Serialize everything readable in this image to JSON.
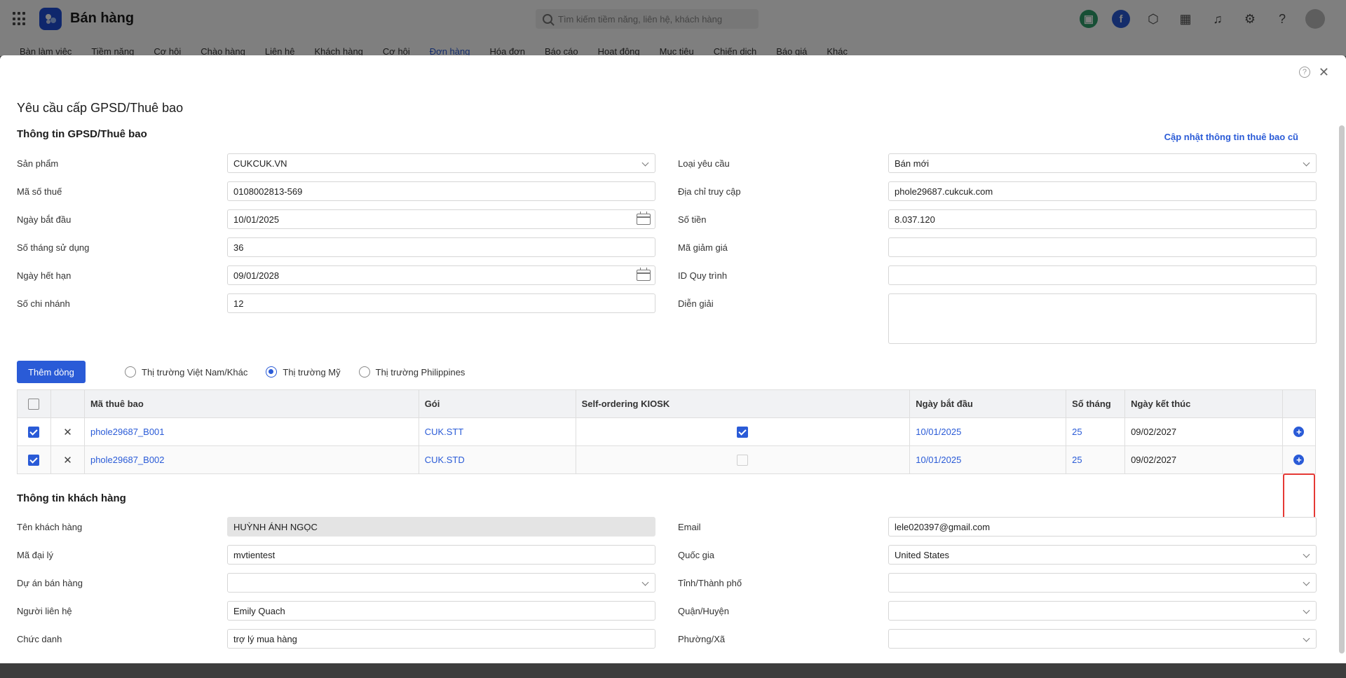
{
  "app": {
    "title": "Bán hàng"
  },
  "search": {
    "placeholder": "Tìm kiếm tiềm năng, liên hệ, khách hàng"
  },
  "nav": {
    "items": [
      "Bàn làm việc",
      "Tiềm năng",
      "Cơ hội",
      "Chào hàng",
      "Liên hệ",
      "Khách hàng",
      "Cơ hội",
      "Đơn hàng",
      "Hóa đơn",
      "Báo cáo",
      "Hoạt động",
      "Mục tiêu",
      "Chiến dịch",
      "Báo giá",
      "Khác"
    ],
    "active_index": 7
  },
  "modal": {
    "title": "Yêu cầu cấp GPSD/Thuê bao",
    "section_license": "Thông tin GPSD/Thuê bao",
    "update_link": "Cập nhật thông tin thuê bao cũ",
    "left_fields": [
      {
        "label": "Sản phẩm",
        "value": "CUKCUK.VN",
        "type": "select"
      },
      {
        "label": "Mã số thuế",
        "value": "0108002813-569",
        "type": "text"
      },
      {
        "label": "Ngày bắt đầu",
        "value": "10/01/2025",
        "type": "date"
      },
      {
        "label": "Số tháng sử dụng",
        "value": "36",
        "type": "text"
      },
      {
        "label": "Ngày hết hạn",
        "value": "09/01/2028",
        "type": "date"
      },
      {
        "label": "Số chi nhánh",
        "value": "12",
        "type": "text"
      }
    ],
    "right_fields": [
      {
        "label": "Loại yêu cầu",
        "value": "Bán mới",
        "type": "select"
      },
      {
        "label": "Địa chỉ truy cập",
        "value": "phole29687.cukcuk.com",
        "type": "text"
      },
      {
        "label": "Số tiền",
        "value": "8.037.120",
        "type": "text"
      },
      {
        "label": "Mã giảm giá",
        "value": "",
        "type": "text"
      },
      {
        "label": "ID Quy trình",
        "value": "",
        "type": "text"
      },
      {
        "label": "Diễn giải",
        "value": "",
        "type": "textarea"
      }
    ],
    "add_row_button": "Thêm dòng",
    "markets": [
      {
        "label": "Thị trường Việt Nam/Khác",
        "checked": false
      },
      {
        "label": "Thị trường Mỹ",
        "checked": true
      },
      {
        "label": "Thị trường Philippines",
        "checked": false
      }
    ],
    "table": {
      "headers": [
        "Mã thuê bao",
        "Gói",
        "Self-ordering KIOSK",
        "Ngày bắt đầu",
        "Số tháng",
        "Ngày kết thúc"
      ],
      "rows": [
        {
          "checked": true,
          "code": "phole29687_B001",
          "package": "CUK.STT",
          "kiosk": true,
          "start": "10/01/2025",
          "months": "25",
          "end": "09/02/2027"
        },
        {
          "checked": true,
          "code": "phole29687_B002",
          "package": "CUK.STD",
          "kiosk": false,
          "start": "10/01/2025",
          "months": "25",
          "end": "09/02/2027"
        }
      ]
    },
    "section_customer": "Thông tin khách hàng",
    "customer_left": [
      {
        "label": "Tên khách hàng",
        "value": "HUỲNH ÁNH NGỌC",
        "type": "readonly"
      },
      {
        "label": "Mã đại lý",
        "value": "mvtientest",
        "type": "text"
      },
      {
        "label": "Dự án bán hàng",
        "value": "",
        "type": "select"
      },
      {
        "label": "Người liên hệ",
        "value": "Emily Quach",
        "type": "text"
      },
      {
        "label": "Chức danh",
        "value": "trợ lý mua hàng",
        "type": "text"
      }
    ],
    "customer_right": [
      {
        "label": "Email",
        "value": "lele020397@gmail.com",
        "type": "text"
      },
      {
        "label": "Quốc gia",
        "value": "United States",
        "type": "select"
      },
      {
        "label": "Tỉnh/Thành phố",
        "value": "",
        "type": "select"
      },
      {
        "label": "Quận/Huyện",
        "value": "",
        "type": "select"
      },
      {
        "label": "Phường/Xã",
        "value": "",
        "type": "select"
      }
    ]
  },
  "colors": {
    "primary": "#2a5bd7",
    "highlight": "#e53935"
  }
}
